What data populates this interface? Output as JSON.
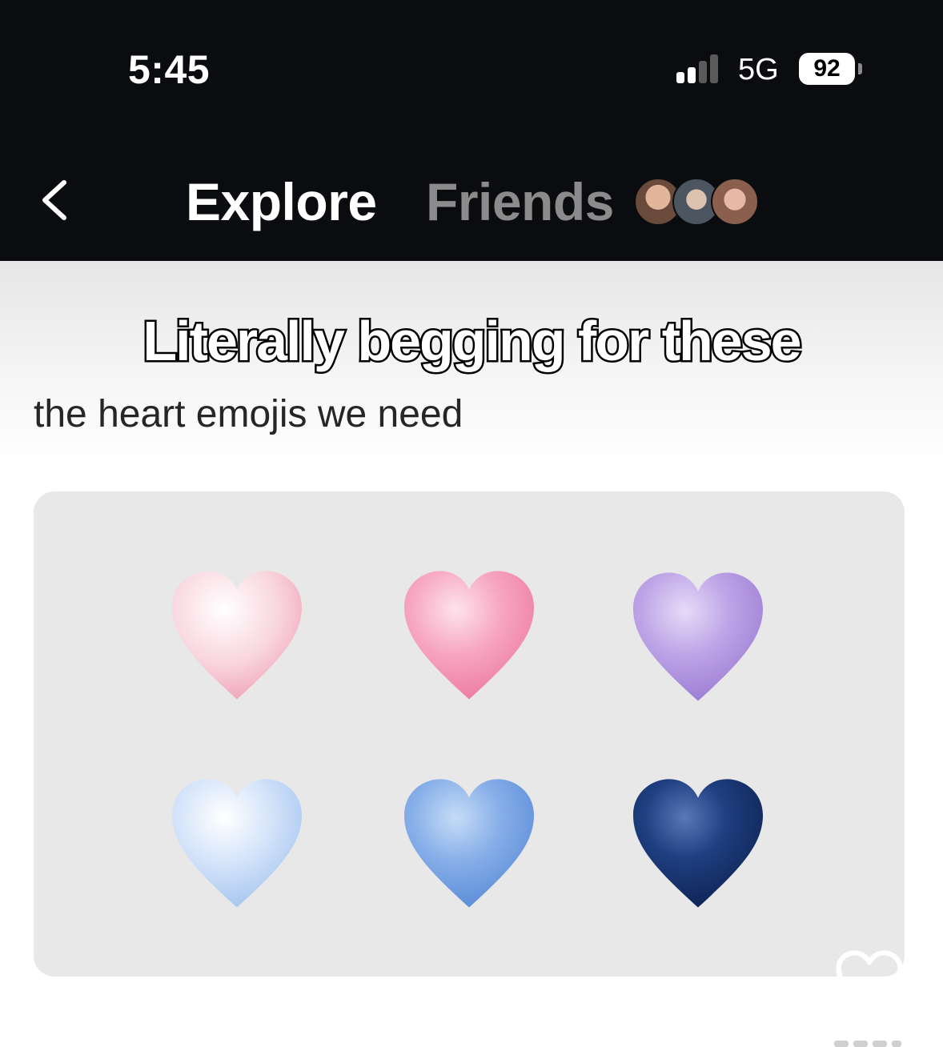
{
  "status_bar": {
    "time": "5:45",
    "network": "5G",
    "battery": "92",
    "signal_bars_active": 2,
    "signal_bars_total": 4
  },
  "nav": {
    "back_icon": "chevron-left-icon",
    "tabs": [
      {
        "label": "Explore",
        "active": true
      },
      {
        "label": "Friends",
        "active": false
      }
    ],
    "friend_avatars_count": 3
  },
  "post": {
    "caption": "Literally begging for these",
    "subtext": "the heart emojis we need",
    "hearts": [
      {
        "name": "light-pink-heart",
        "color": "#f7c6d3"
      },
      {
        "name": "pink-heart",
        "color": "#f59ab9"
      },
      {
        "name": "lavender-heart",
        "color": "#b99be0"
      },
      {
        "name": "light-blue-heart",
        "color": "#c7dcf7"
      },
      {
        "name": "blue-heart",
        "color": "#7fa8e6"
      },
      {
        "name": "navy-heart",
        "color": "#1b3a78"
      }
    ]
  },
  "actions": {
    "like_icon": "heart-outline-icon"
  },
  "colors": {
    "header_bg": "#0b0c0f",
    "active_tab": "#ffffff",
    "inactive_tab": "#8b8b8b",
    "card_bg": "#e8e8e8"
  }
}
